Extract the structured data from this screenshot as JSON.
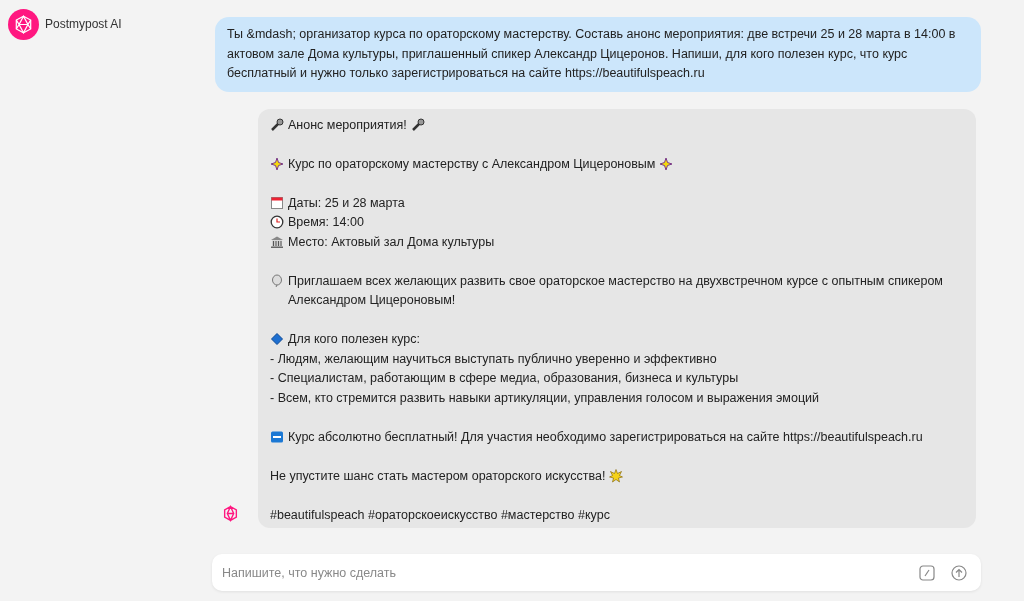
{
  "app": {
    "name": "Postmypost AI"
  },
  "user_message": {
    "text": "Ты &mdash; организатор курса по ораторскому мастерству. Составь анонс мероприятия: две встречи 25 и 28 марта в 14:00 в актовом зале Дома культуры, приглашенный спикер Александр Цицеронов. Напиши, для кого полезен курс, что курс бесплатный и нужно только зарегистрироваться на сайте https://beautifulspeach.ru"
  },
  "ai_message": {
    "paragraphs": [
      {
        "lines": [
          {
            "kind": "microphone",
            "text": "Анонс мероприятия!"
          }
        ]
      },
      {
        "lines": [
          {
            "kind": "sparkle",
            "text": "Курс по ораторскому мастерству с Александром Цицероновым"
          }
        ]
      },
      {
        "lines": [
          {
            "kind": "calendar",
            "text": "Даты: 25 и 28 марта"
          },
          {
            "kind": "clock",
            "text": "Время: 14:00"
          },
          {
            "kind": "building",
            "text": "Место: Актовый зал Дома культуры"
          }
        ]
      },
      {
        "lines": [
          {
            "kind": "balloon",
            "text": "Приглашаем всех желающих развить свое ораторское мастерство на двухвстречном курсе с опытным спикером Александром Цицероновым!"
          }
        ]
      },
      {
        "lines": [
          {
            "kind": "diamond",
            "text": "Для кого полезен курс:"
          },
          {
            "kind": "plain",
            "text": "- Людям, желающим научиться выступать публично уверенно и эффективно"
          },
          {
            "kind": "plain",
            "text": "- Специалистам, работающим в сфере медиа, образования, бизнеса и культуры"
          },
          {
            "kind": "plain",
            "text": "- Всем, кто стремится развить навыки артикуляции, управления голосом и выражения эмоций"
          }
        ]
      },
      {
        "lines": [
          {
            "kind": "free",
            "text": "Курс абсолютно бесплатный! Для участия необходимо зарегистрироваться на сайте https://beautifulspeach.ru"
          }
        ]
      },
      {
        "lines": [
          {
            "kind": "burst",
            "text": "Не упустите шанс стать мастером ораторского искусства!"
          }
        ]
      },
      {
        "lines": [
          {
            "kind": "plain",
            "text": "#beautifulspeach #ораторскоеискусство #мастерство #курс"
          }
        ]
      }
    ]
  },
  "composer": {
    "placeholder": "Напишите, что нужно сделать"
  }
}
